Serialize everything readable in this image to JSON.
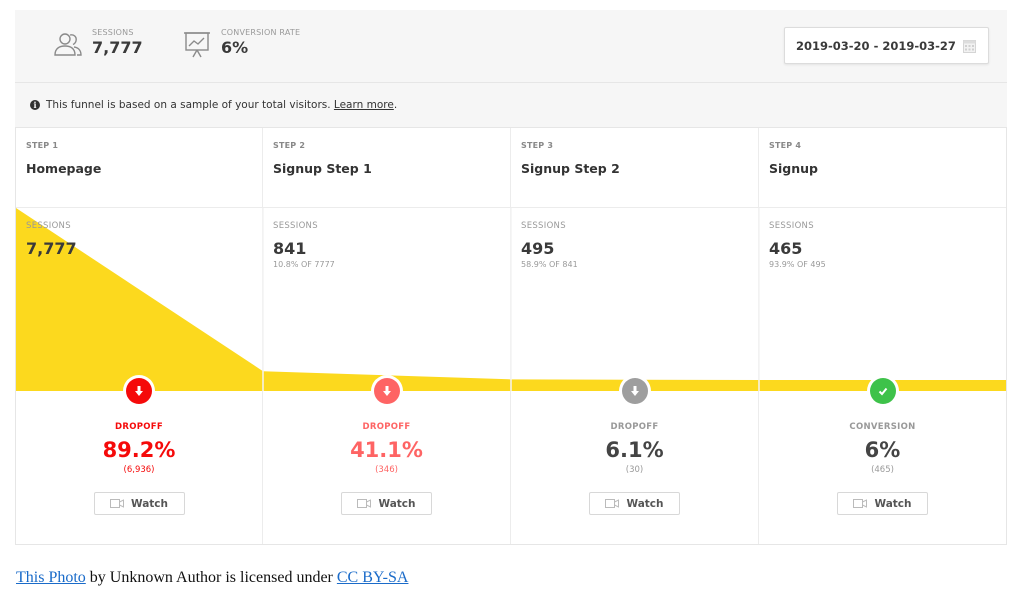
{
  "header": {
    "sessions": {
      "label": "SESSIONS",
      "value": "7,777",
      "icon": "users-icon"
    },
    "conversion": {
      "label": "CONVERSION RATE",
      "value": "6%",
      "icon": "presentation-chart-icon"
    },
    "date_range": {
      "value": "2019-03-20 - 2019-03-27",
      "icon": "calendar-icon"
    }
  },
  "info": {
    "text": "This funnel is based on a sample of your total visitors.",
    "link": "Learn more",
    "suffix": ".",
    "icon": "info-icon"
  },
  "colors": {
    "funnel_fill": "#fcd91e",
    "dropoff_strong": "#f50a0a",
    "dropoff_medium": "#fe6464",
    "dropoff_neutral": "#9e9e9e",
    "conversion": "#3ec24a"
  },
  "steps": [
    {
      "step": "STEP 1",
      "name": "Homepage",
      "sessions_label": "SESSIONS",
      "sessions": "7,777",
      "share": "",
      "outcome_label": "DROPOFF",
      "outcome_value": "89.2%",
      "outcome_count": "(6,936)",
      "outcome_type": "dropoff_strong",
      "watch_label": "Watch"
    },
    {
      "step": "STEP 2",
      "name": "Signup Step 1",
      "sessions_label": "SESSIONS",
      "sessions": "841",
      "share": "10.8% OF 7777",
      "outcome_label": "DROPOFF",
      "outcome_value": "41.1%",
      "outcome_count": "(346)",
      "outcome_type": "dropoff_medium",
      "watch_label": "Watch"
    },
    {
      "step": "STEP 3",
      "name": "Signup Step 2",
      "sessions_label": "SESSIONS",
      "sessions": "495",
      "share": "58.9% OF 841",
      "outcome_label": "DROPOFF",
      "outcome_value": "6.1%",
      "outcome_count": "(30)",
      "outcome_type": "dropoff_neutral",
      "watch_label": "Watch"
    },
    {
      "step": "STEP 4",
      "name": "Signup",
      "sessions_label": "SESSIONS",
      "sessions": "465",
      "share": "93.9% OF 495",
      "outcome_label": "CONVERSION",
      "outcome_value": "6%",
      "outcome_count": "(465)",
      "outcome_type": "conversion",
      "watch_label": "Watch"
    }
  ],
  "funnel_sessions": [
    7777,
    841,
    495,
    465
  ],
  "credit": {
    "link1": "This Photo",
    "middle": " by Unknown Author is licensed under ",
    "link2": "CC BY-SA"
  }
}
